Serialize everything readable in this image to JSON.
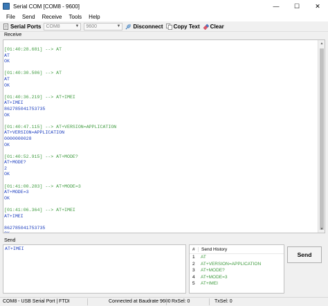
{
  "window": {
    "title": "Serial COM [COM8 - 9600]",
    "minimize_glyph": "—",
    "maximize_glyph": "☐",
    "close_glyph": "✕"
  },
  "menu": [
    "File",
    "Send",
    "Receive",
    "Tools",
    "Help"
  ],
  "toolbar": {
    "serial_ports_label": "Serial Ports",
    "port_value": "COM8",
    "baud_value": "9600",
    "disconnect_label": "Disconnect",
    "copy_text_label": "Copy Text",
    "clear_label": "Clear"
  },
  "receive": {
    "group_label": "Receive",
    "lines": [
      {
        "text": "[01:40:28.681] --> AT",
        "kind": "cmd"
      },
      {
        "text": "AT",
        "kind": "echo"
      },
      {
        "text": "OK",
        "kind": "resp"
      },
      {
        "text": "",
        "kind": "blank"
      },
      {
        "text": "[01:40:30.506] --> AT",
        "kind": "cmd"
      },
      {
        "text": "AT",
        "kind": "echo"
      },
      {
        "text": "OK",
        "kind": "resp"
      },
      {
        "text": "",
        "kind": "blank"
      },
      {
        "text": "[01:40:36.219] --> AT+IMEI",
        "kind": "cmd"
      },
      {
        "text": "AT+IMEI",
        "kind": "echo"
      },
      {
        "text": "862785041753735",
        "kind": "resp"
      },
      {
        "text": "OK",
        "kind": "resp"
      },
      {
        "text": "",
        "kind": "blank"
      },
      {
        "text": "[01:40:47.115] --> AT+VERSION=APPLICATION",
        "kind": "cmd"
      },
      {
        "text": "AT+VERSION=APPLICATION",
        "kind": "echo"
      },
      {
        "text": "0000000028",
        "kind": "resp"
      },
      {
        "text": "OK",
        "kind": "resp"
      },
      {
        "text": "",
        "kind": "blank"
      },
      {
        "text": "[01:40:52.915] --> AT+MODE?",
        "kind": "cmd"
      },
      {
        "text": "AT+MODE?",
        "kind": "echo"
      },
      {
        "text": "2",
        "kind": "resp"
      },
      {
        "text": "OK",
        "kind": "resp"
      },
      {
        "text": "",
        "kind": "blank"
      },
      {
        "text": "[01:41:00.283] --> AT+MODE=3",
        "kind": "cmd"
      },
      {
        "text": "AT+MODE=3",
        "kind": "echo"
      },
      {
        "text": "OK",
        "kind": "resp"
      },
      {
        "text": "",
        "kind": "blank"
      },
      {
        "text": "[01:41:06.364] --> AT+IMEI",
        "kind": "cmd"
      },
      {
        "text": "AT+IMEI",
        "kind": "echo"
      },
      {
        "text": "",
        "kind": "blank"
      },
      {
        "text": "862785041753735",
        "kind": "resp"
      },
      {
        "text": "OK",
        "kind": "resp"
      }
    ]
  },
  "send": {
    "group_label": "Send",
    "input_value": "AT+IMEI",
    "button_label": "Send"
  },
  "history": {
    "col_number": "#",
    "col_title": "Send History",
    "items": [
      "AT",
      "AT+VERSION=APPLICATION",
      "AT+MODE?",
      "AT+MODE=3",
      "AT+IMEI"
    ]
  },
  "status": {
    "port": "COM8 - USB Serial Port | FTDI",
    "connection": "Connected at Baudrate 9600",
    "rxsel": "RxSel: 0",
    "txsel": "TxSel: 0"
  },
  "colors": {
    "command": "#3f9b3f",
    "response": "#1e3fbf"
  }
}
